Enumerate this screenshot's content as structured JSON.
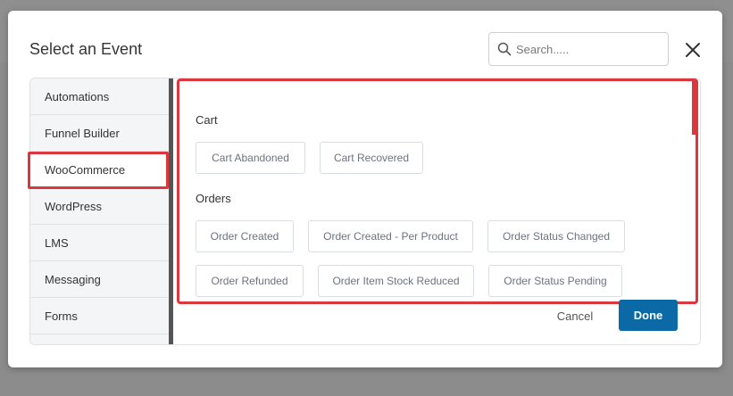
{
  "modal": {
    "title": "Select an Event",
    "search_placeholder": "Search.....",
    "close_icon": "close-icon"
  },
  "sidebar": {
    "items": [
      {
        "label": "Automations"
      },
      {
        "label": "Funnel Builder"
      },
      {
        "label": "WooCommerce",
        "active": true
      },
      {
        "label": "WordPress"
      },
      {
        "label": "LMS"
      },
      {
        "label": "Messaging"
      },
      {
        "label": "Forms"
      }
    ]
  },
  "content": {
    "sections": [
      {
        "title": "Cart",
        "events": [
          "Cart Abandoned",
          "Cart Recovered"
        ]
      },
      {
        "title": "Orders",
        "events": [
          "Order Created",
          "Order Created - Per Product",
          "Order Status Changed",
          "Order Refunded",
          "Order Item Stock Reduced",
          "Order Status Pending"
        ]
      }
    ]
  },
  "footer": {
    "cancel_label": "Cancel",
    "done_label": "Done"
  },
  "colors": {
    "highlight": "#d9383f",
    "primary": "#0b6aa6"
  }
}
